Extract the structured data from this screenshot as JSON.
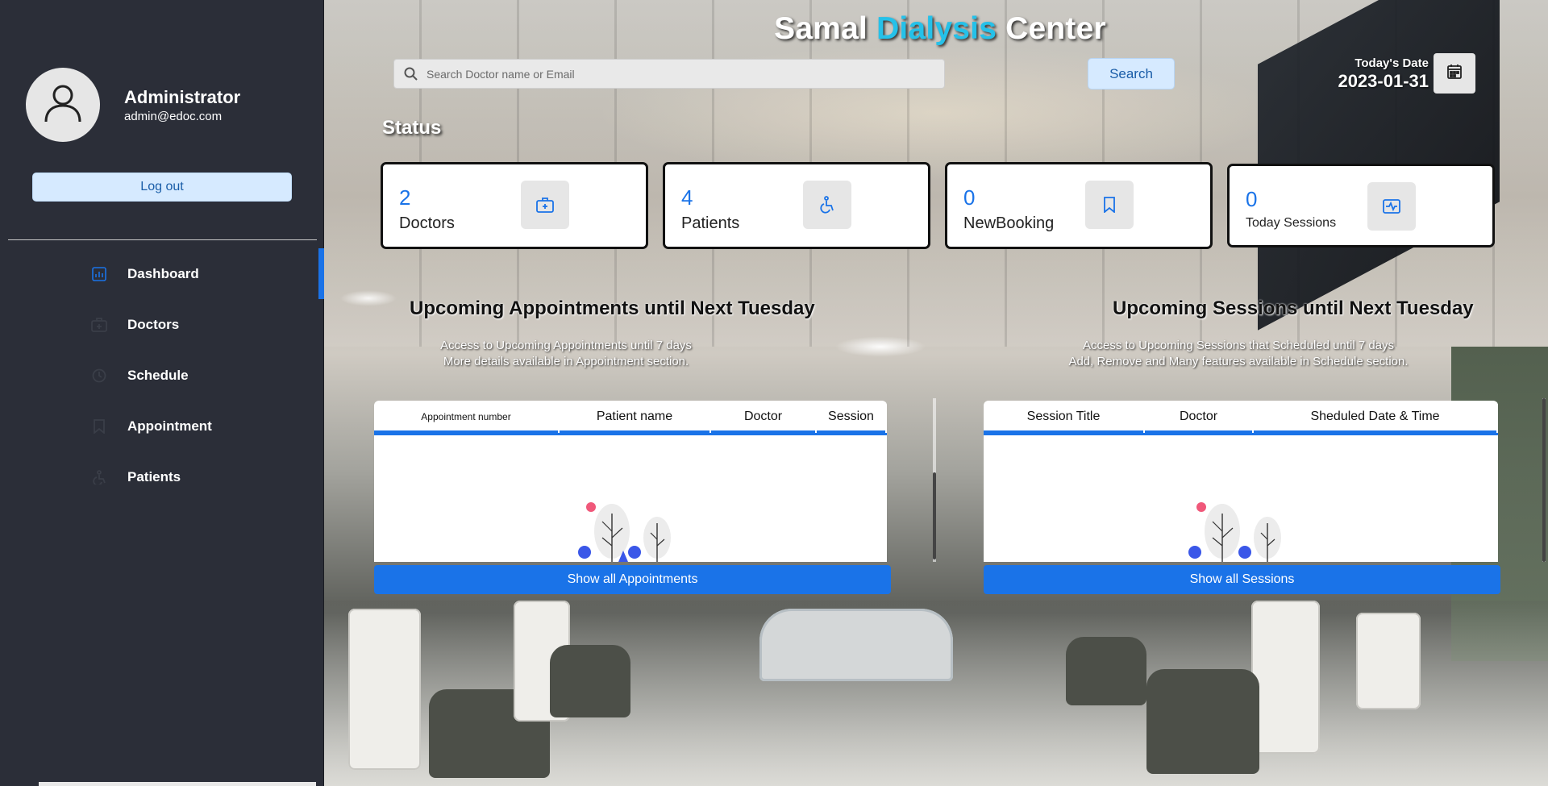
{
  "sidebar": {
    "profile": {
      "name": "Administrator",
      "email": "admin@edoc.com"
    },
    "logout_label": "Log out",
    "menu": [
      {
        "label": "Dashboard",
        "icon": "dashboard-icon",
        "active": true
      },
      {
        "label": "Doctors",
        "icon": "doctor-icon",
        "active": false
      },
      {
        "label": "Schedule",
        "icon": "schedule-icon",
        "active": false
      },
      {
        "label": "Appointment",
        "icon": "bookmark-icon",
        "active": false
      },
      {
        "label": "Patients",
        "icon": "patient-icon",
        "active": false
      }
    ]
  },
  "header": {
    "brand_part1": "Samal ",
    "brand_part2": "Dialysis",
    "brand_part3": " Center",
    "search_placeholder": "Search Doctor name or Email",
    "search_label": "Search",
    "date_label": "Today's Date",
    "date_value": "2023-01-31"
  },
  "status": {
    "title": "Status",
    "cards": [
      {
        "value": "2",
        "label": "Doctors",
        "icon": "medical-kit-icon"
      },
      {
        "value": "4",
        "label": "Patients",
        "icon": "wheelchair-icon"
      },
      {
        "value": "0",
        "label": "NewBooking",
        "icon": "bookmark-icon"
      },
      {
        "value": "0",
        "label": "Today Sessions",
        "icon": "session-icon"
      }
    ]
  },
  "appointments": {
    "title": "Upcoming Appointments until Next Tuesday",
    "desc1": "Access to Upcoming Appointments until 7 days",
    "desc2": "More details available in Appointment section.",
    "columns": [
      "Appointment number",
      "Patient name",
      "Doctor",
      "Session"
    ],
    "button": "Show all Appointments"
  },
  "sessions": {
    "title": "Upcoming Sessions until Next Tuesday",
    "desc1": "Access to Upcoming Sessions that Scheduled until 7 days",
    "desc2": "Add, Remove and Many features available in Schedule section.",
    "columns": [
      "Session Title",
      "Doctor",
      "Sheduled Date & Time"
    ],
    "button": "Show all Sessions"
  },
  "colors": {
    "accent": "#1a73e8",
    "brand_accent": "#25c1e9",
    "sidebar_bg": "#2b2e38"
  }
}
